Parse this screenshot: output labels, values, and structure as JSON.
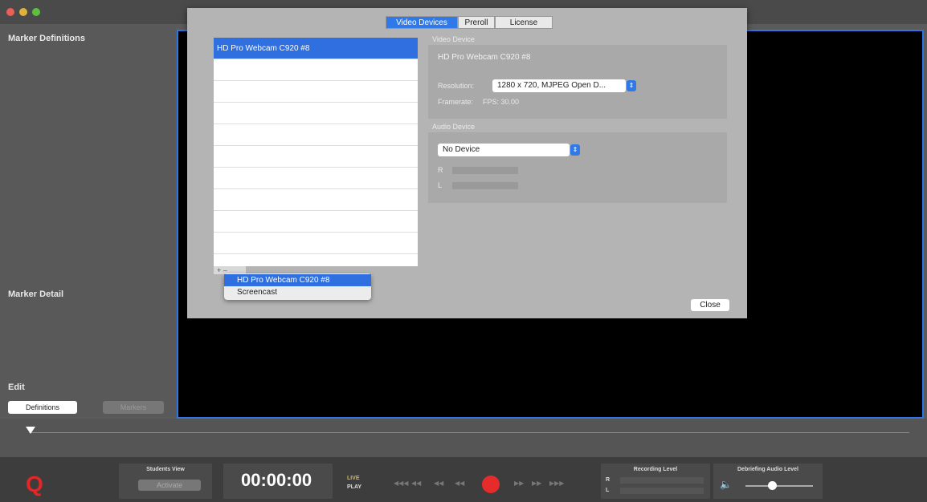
{
  "colors": {
    "accent": "#2f75e6",
    "record": "#e62b2b",
    "logo": "#e32626"
  },
  "sidebar": {
    "marker_definitions": "Marker Definitions",
    "marker_detail": "Marker Detail",
    "edit": "Edit",
    "definitions_button": "Definitions",
    "markers_button": "Markers"
  },
  "dialog": {
    "tabs": [
      "Video Devices",
      "Preroll",
      "License"
    ],
    "devices": [
      "HD Pro Webcam C920 #8"
    ],
    "video_device_heading": "Video Device",
    "video_device_name": "HD Pro Webcam C920 #8",
    "resolution_label": "Resolution:",
    "resolution_value": "1280 x 720, MJPEG Open D...",
    "framerate_label": "Framerate:",
    "framerate_value": "FPS: 30.00",
    "audio_device_heading": "Audio Device",
    "audio_device_value": "No Device",
    "meter_r": "R",
    "meter_l": "L",
    "add_device_menu": [
      "HD Pro Webcam C920 #8",
      "Screencast"
    ],
    "close_button": "Close"
  },
  "transport": {
    "logo": "Q",
    "students_view_label": "Students View",
    "activate_button": "Activate",
    "timecode": "00:00:00",
    "live_label": "LIVE",
    "play_label": "PLAY",
    "recording_level_label": "Recording Level",
    "meter_r": "R",
    "meter_l": "L",
    "debriefing_audio_label": "Debriefing Audio Level",
    "volume_icon": "speaker-mute-icon"
  }
}
